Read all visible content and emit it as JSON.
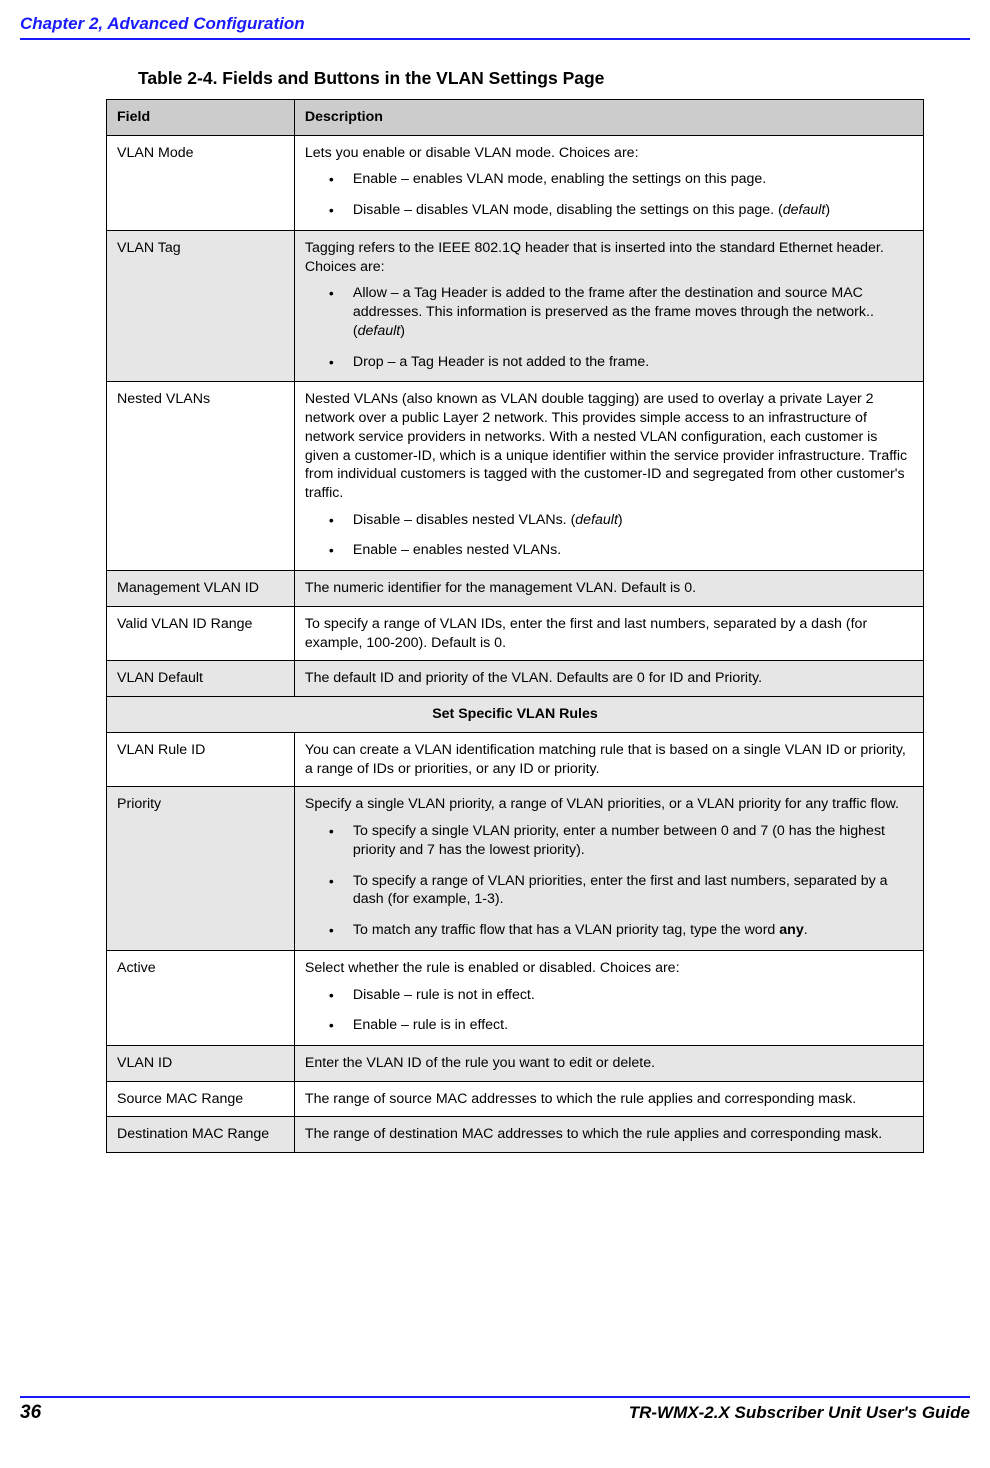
{
  "header": {
    "chapter": "Chapter 2, Advanced Configuration"
  },
  "table": {
    "title": "Table 2-4. Fields and Buttons in the VLAN Settings Page",
    "columns": {
      "field": "Field",
      "description": "Description"
    },
    "section_label": "Set Specific VLAN Rules",
    "rows": {
      "vlan_mode": {
        "field": "VLAN Mode",
        "intro": "Lets you enable or disable VLAN mode. Choices are:",
        "b1": "Enable – enables VLAN mode, enabling the settings on this page.",
        "b2_pre": "Disable – disables VLAN mode, disabling the settings on this page. (",
        "b2_def": "default",
        "b2_post": ")"
      },
      "vlan_tag": {
        "field": "VLAN Tag",
        "intro": "Tagging refers to the IEEE 802.1Q header that is inserted into the standard Ethernet header. Choices are:",
        "b1_pre": "Allow – a Tag Header is added to the frame after the destination and source MAC addresses. This information is preserved as the frame moves through the network.. (",
        "b1_def": "default",
        "b1_post": ")",
        "b2": "Drop – a Tag Header is not added to the frame."
      },
      "nested": {
        "field": "Nested VLANs",
        "intro": "Nested VLANs (also known as VLAN double tagging) are used to overlay a private Layer 2 network over a public Layer 2 network. This provides simple access to an infrastructure of network service providers in networks. With a nested VLAN configuration, each customer is given a customer-ID, which is a unique identifier within the service provider infrastructure. Traffic from individual customers is tagged with the customer-ID and segregated from other customer's traffic.",
        "b1_pre": "Disable – disables nested VLANs. (",
        "b1_def": "default",
        "b1_post": ")",
        "b2": "Enable – enables nested VLANs."
      },
      "mgmt": {
        "field": "Management VLAN ID",
        "desc": "The numeric identifier for the management VLAN. Default is 0."
      },
      "range": {
        "field": "Valid VLAN ID Range",
        "desc": "To specify a range of VLAN IDs, enter the first and last numbers, separated by a dash (for example, 100-200). Default is 0."
      },
      "default": {
        "field": "VLAN Default",
        "desc": "The default ID and priority of the VLAN. Defaults are 0 for ID and Priority."
      },
      "rule_id": {
        "field": "VLAN Rule ID",
        "desc": "You can create a VLAN identification matching rule that is based on a single VLAN ID or priority, a range of IDs or priorities, or any ID or priority."
      },
      "priority": {
        "field": "Priority",
        "intro": "Specify a single VLAN priority, a range of VLAN priorities, or a VLAN priority for any traffic flow.",
        "b1": "To specify a single VLAN priority, enter a number between 0 and 7 (0 has the highest priority and 7 has the lowest priority).",
        "b2": "To specify a range of VLAN priorities, enter the first and last numbers, separated by a dash (for example, 1-3).",
        "b3_pre": "To match any traffic flow that has a VLAN priority tag, type the word ",
        "b3_bold": "any",
        "b3_post": "."
      },
      "active": {
        "field": "Active",
        "intro": "Select whether the rule is enabled or disabled. Choices are:",
        "b1": "Disable – rule is not in effect.",
        "b2": "Enable – rule is in effect."
      },
      "vlan_id": {
        "field": "VLAN ID",
        "desc": "Enter the VLAN ID of the rule you want to edit or delete."
      },
      "src_mac": {
        "field": "Source MAC Range",
        "desc": "The range of source MAC addresses to which the rule applies and corresponding mask."
      },
      "dst_mac": {
        "field": "Destination MAC Range",
        "desc": "The range of destination MAC addresses to which the rule applies and corresponding mask."
      }
    }
  },
  "footer": {
    "page_number": "36",
    "guide": "TR-WMX-2.X Subscriber Unit User's Guide"
  }
}
